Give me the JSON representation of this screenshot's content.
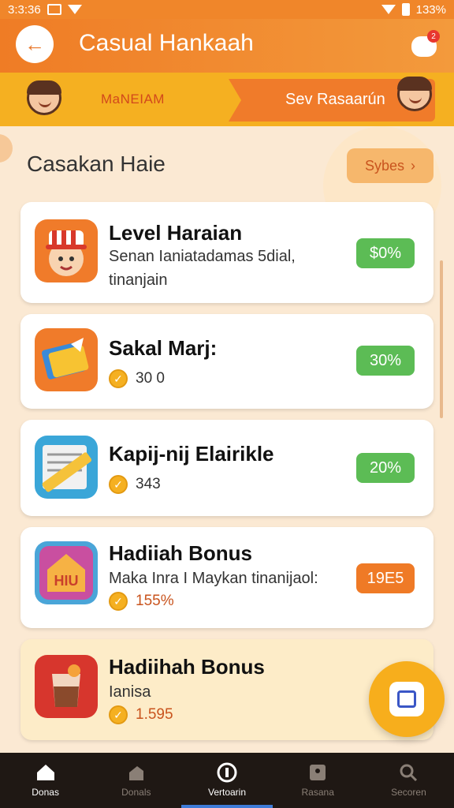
{
  "status_bar": {
    "time": "3:3:36",
    "battery": "133%"
  },
  "app_bar": {
    "title": "Casual Hankaah",
    "notification_count": "2"
  },
  "promo": {
    "left_label": "MaNEIAM",
    "right_label": "Sev Rasaarún"
  },
  "section": {
    "title": "Casakan Haie",
    "see_all_label": "Sybes"
  },
  "cards": [
    {
      "title": "Level Haraian",
      "subtitle": "Senan Ianiatadamas 5dial, tinanjain",
      "badge": "$0%",
      "badge_color": "#5cbc55",
      "icon": "hat-boy-icon"
    },
    {
      "title": "Sakal Marj:",
      "coin_value": "30 0",
      "badge": "30%",
      "badge_color": "#5cbc55",
      "icon": "ticket-icon"
    },
    {
      "title": "Kapij-nij Elairikle",
      "coin_value": "343",
      "badge": "20%",
      "badge_color": "#5cbc55",
      "icon": "newspaper-icon"
    },
    {
      "title": "Hadiiah Bonus",
      "subtitle": "Maka Inra I Maykan tinanijaol:",
      "coin_value": "155%",
      "badge": "19E5",
      "badge_color": "#ef7a26",
      "icon": "hiu-box-icon"
    },
    {
      "title": "Hadiihah Bonus",
      "subtitle": "Ianisa",
      "coin_value": "1.595",
      "icon": "drink-icon"
    }
  ],
  "bottom_nav": [
    {
      "label": "Donas",
      "icon": "home-icon"
    },
    {
      "label": "Donals",
      "icon": "chart-icon"
    },
    {
      "label": "Vertoarin",
      "icon": "info-icon"
    },
    {
      "label": "Rasana",
      "icon": "bag-icon"
    },
    {
      "label": "Secoren",
      "icon": "search-icon"
    }
  ],
  "colors": {
    "primary": "#ef7c25",
    "accent": "#f5b021",
    "green": "#5cbc55",
    "nav_bg": "#1f1814"
  }
}
